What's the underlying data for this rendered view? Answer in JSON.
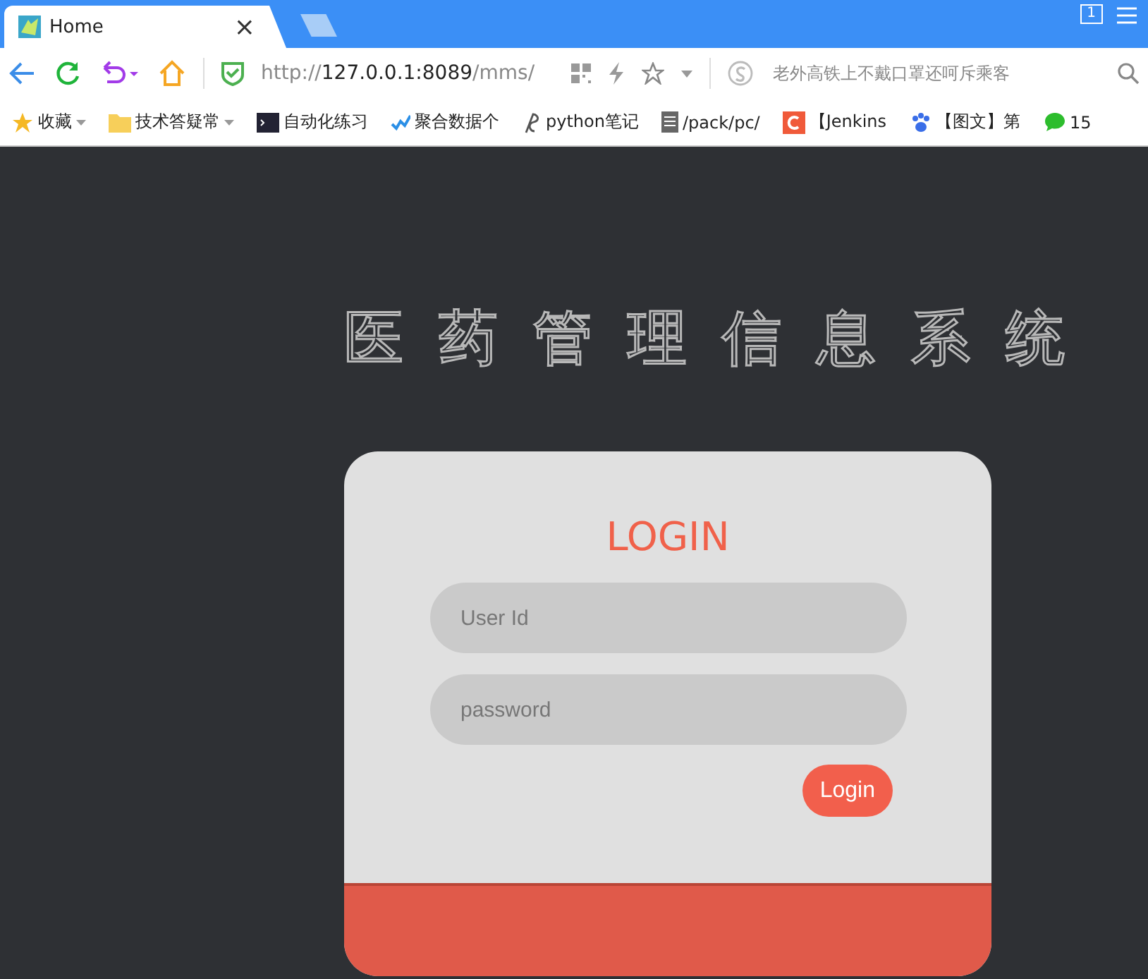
{
  "tabs": [
    {
      "label": "Home",
      "close": "×",
      "selected": true
    },
    {
      "selected": false
    }
  ],
  "address": {
    "prefix": "http://",
    "host": "127.0.0.1:8089",
    "path": "/mms/"
  },
  "search": {
    "placeholder": "老外高铁上不戴口罩还呵斥乘客"
  },
  "window_badge": "1",
  "bookmarks": [
    {
      "kind": "star",
      "label": "收藏",
      "has_menu": true
    },
    {
      "kind": "folder",
      "label": "技术答疑常",
      "has_menu": true
    },
    {
      "kind": "terminal",
      "label": "自动化练习",
      "has_menu": false
    },
    {
      "kind": "check",
      "label": "聚合数据个",
      "has_menu": false
    },
    {
      "kind": "python",
      "label": "python笔记",
      "has_menu": false
    },
    {
      "kind": "doc",
      "label": "/pack/pc/",
      "has_menu": false
    },
    {
      "kind": "c",
      "label": "【Jenkins",
      "has_menu": false
    },
    {
      "kind": "paw",
      "label": "【图文】第",
      "has_menu": false
    },
    {
      "kind": "chat",
      "label": "15",
      "has_menu": false
    }
  ],
  "page": {
    "title": "医药管理信息系统",
    "login": {
      "heading": "LOGIN",
      "fields": [
        {
          "placeholder": "User Id"
        },
        {
          "placeholder": "password"
        }
      ],
      "button": "Login"
    }
  }
}
